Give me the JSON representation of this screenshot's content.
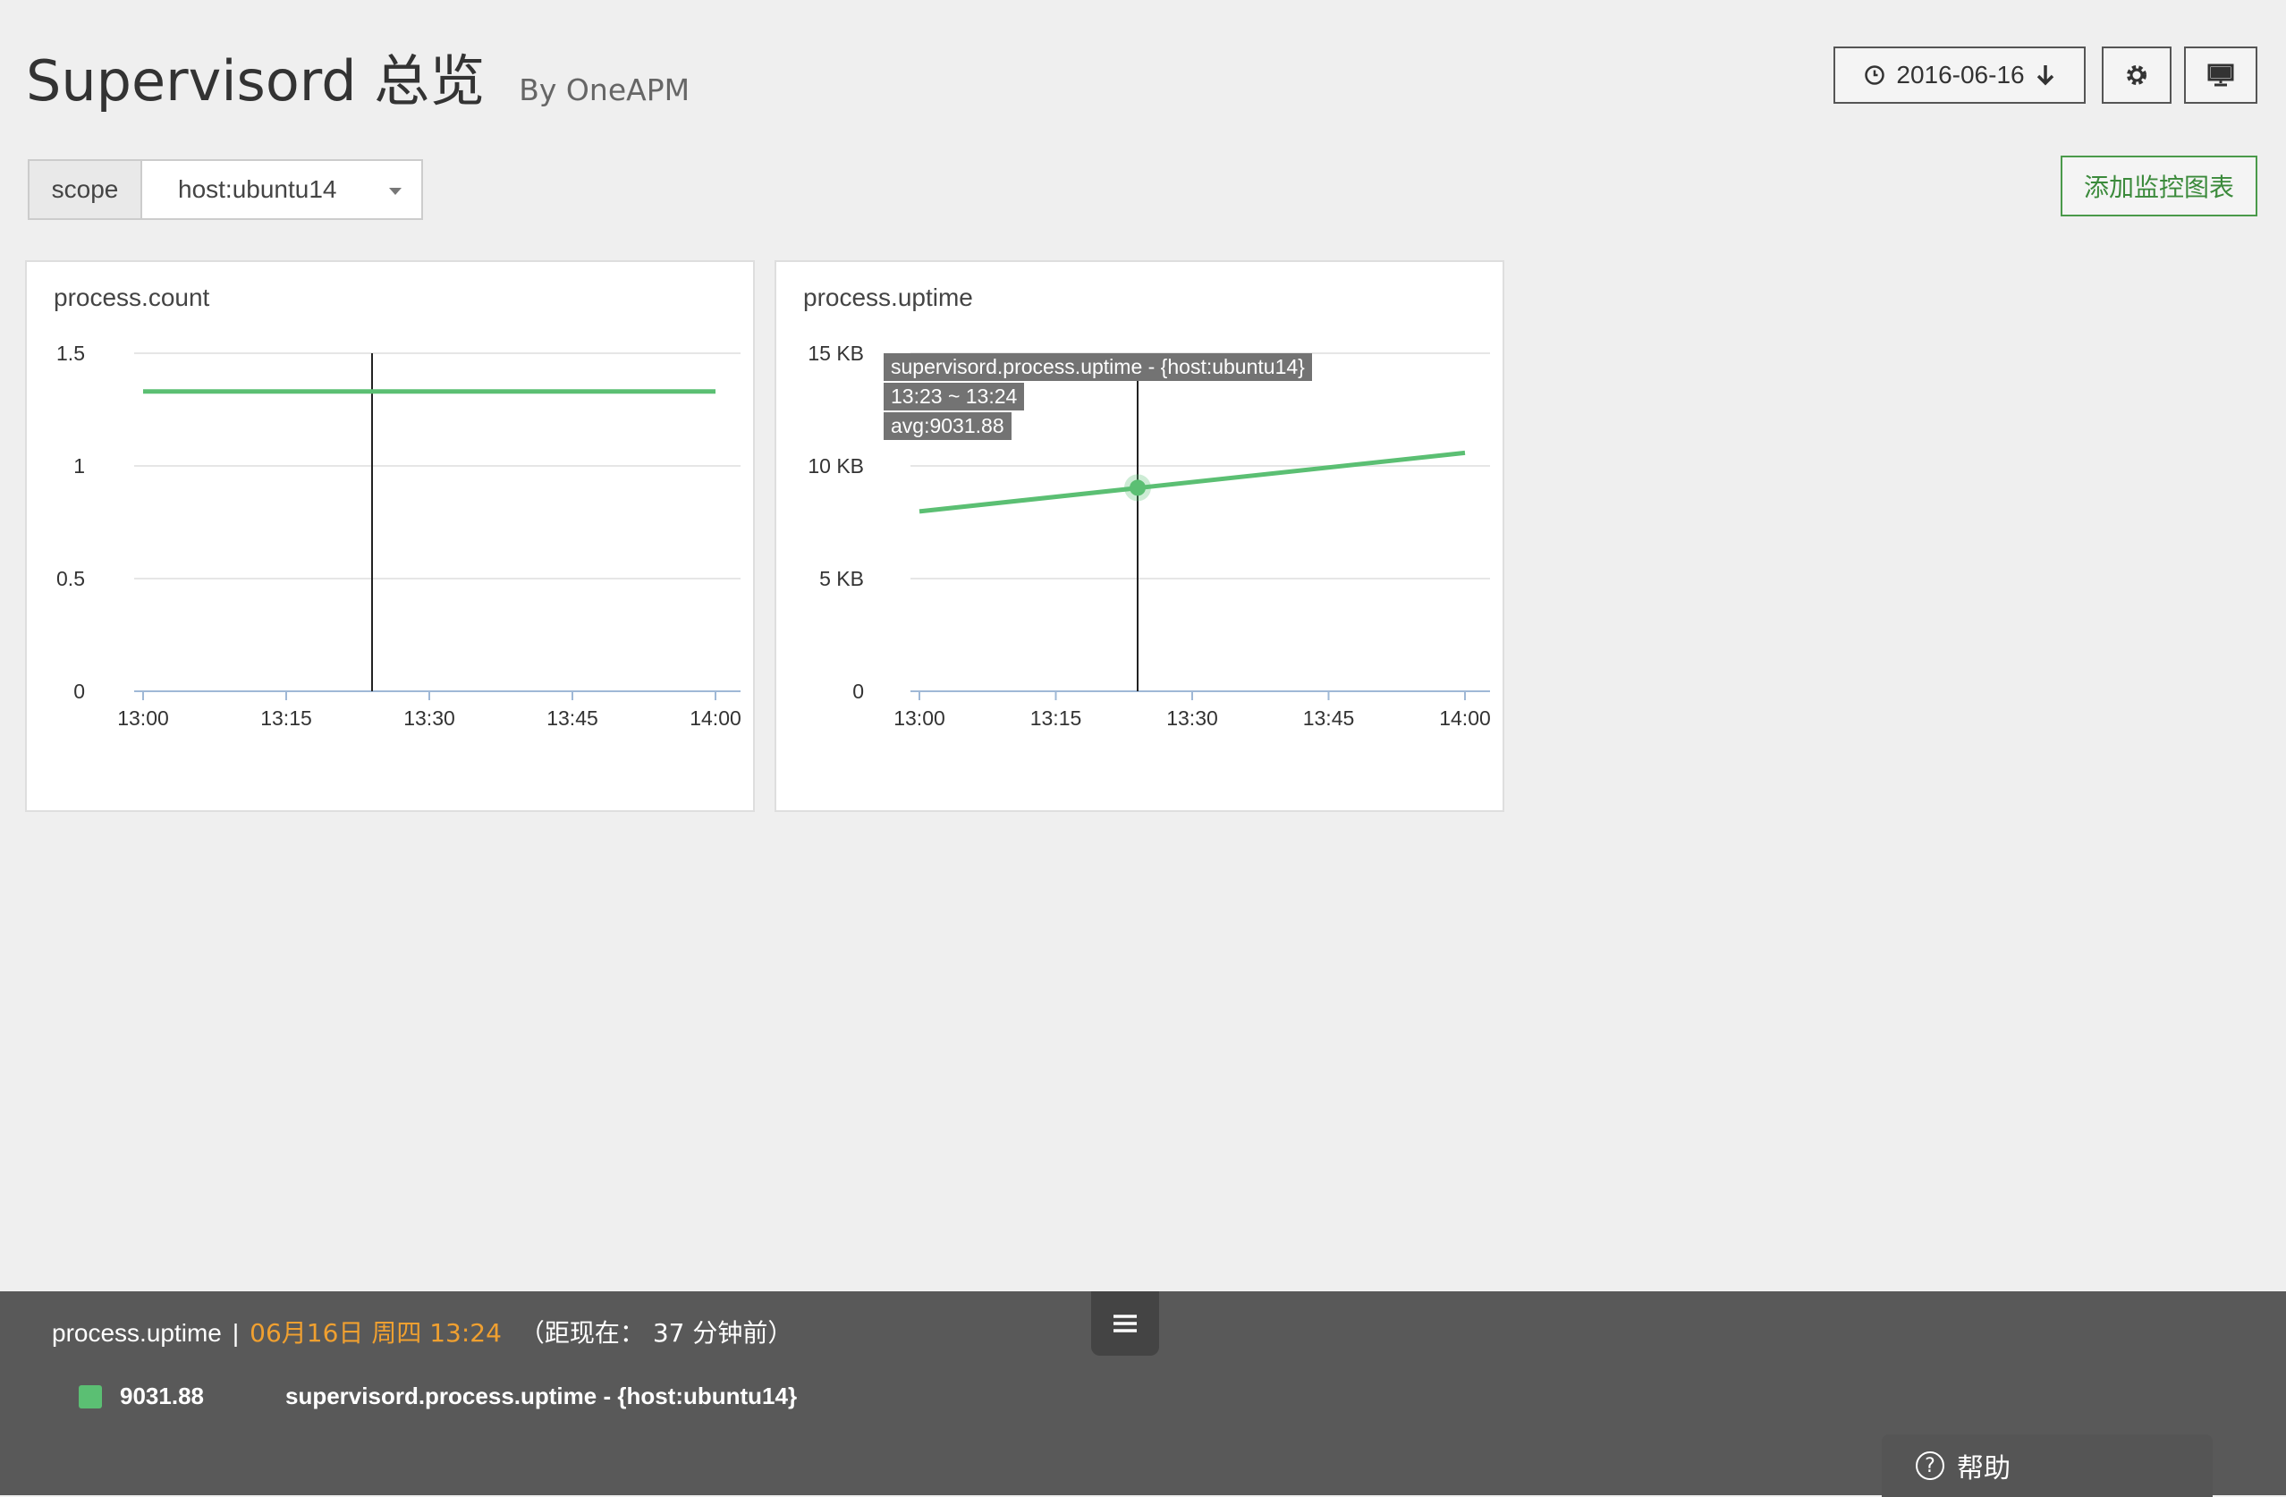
{
  "header": {
    "title": "Supervisord 总览",
    "subtitle": "By OneAPM",
    "date_label": "2016-06-16",
    "icons": {
      "date": "clock-icon",
      "date_action": "arrow-down-icon",
      "settings": "gear-icon",
      "display": "monitor-icon"
    }
  },
  "scope": {
    "label": "scope",
    "selected": "host:ubuntu14"
  },
  "actions": {
    "add_chart": "添加监控图表"
  },
  "colors": {
    "series": "#5bbf73",
    "accent": "#f0a030",
    "bar_background": "#595959"
  },
  "chart_data": [
    {
      "type": "line",
      "title": "process.count",
      "x_ticks": [
        "13:00",
        "13:15",
        "13:30",
        "13:45",
        "14:00"
      ],
      "y_ticks": [
        "0",
        "0.5",
        "1",
        "1.5"
      ],
      "ylim": [
        0,
        1.5
      ],
      "xlim": [
        "13:00",
        "14:00"
      ],
      "grid": true,
      "series": [
        {
          "x": [
            "13:00",
            "14:00"
          ],
          "values": [
            1.33,
            1.33
          ]
        }
      ],
      "crosshair_x": "13:24"
    },
    {
      "type": "line",
      "title": "process.uptime",
      "x_ticks": [
        "13:00",
        "13:15",
        "13:30",
        "13:45",
        "14:00"
      ],
      "y_ticks": [
        "0",
        "5 KB",
        "10 KB",
        "15 KB"
      ],
      "ylim": [
        0,
        15000
      ],
      "xlim": [
        "13:00",
        "14:00"
      ],
      "grid": true,
      "series": [
        {
          "name": "supervisord.process.uptime - {host:ubuntu14}",
          "x": [
            "13:00",
            "14:00"
          ],
          "values": [
            7980,
            10580
          ]
        }
      ],
      "crosshair_x": "13:24",
      "highlight_point": {
        "x": "13:24",
        "y": 9031.88
      },
      "tooltip": {
        "series": "supervisord.process.uptime - {host:ubuntu14}",
        "range": "13:23 ~ 13:24",
        "avg": "avg:9031.88"
      }
    }
  ],
  "bottom_bar": {
    "metric": "process.uptime",
    "separator": "|",
    "date": "06月16日 周四 13:24",
    "ago": "（距现在： 37 分钟前）",
    "menu_icon": "menu-icon",
    "legend": [
      {
        "value": "9031.88",
        "name": "supervisord.process.uptime - {host:ubuntu14}"
      }
    ],
    "help": "帮助"
  }
}
